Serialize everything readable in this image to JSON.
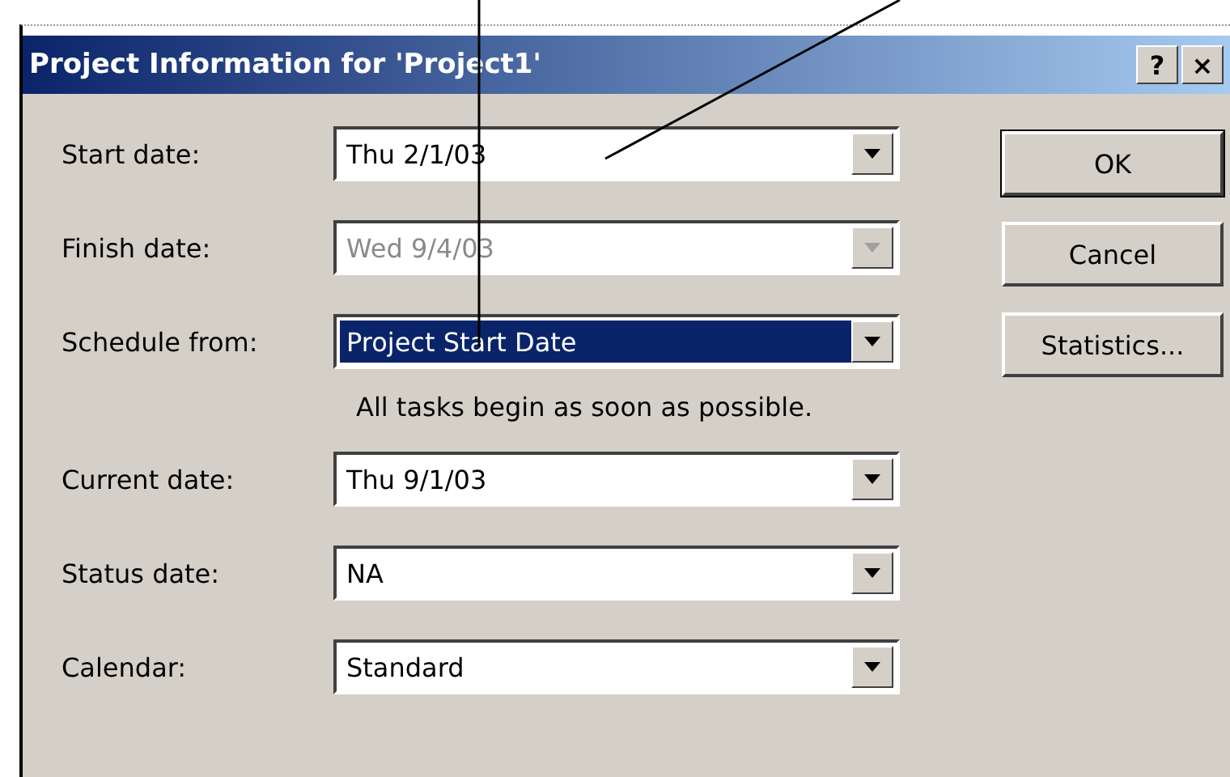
{
  "window": {
    "title": "Project Information for 'Project1'",
    "help_button": "?",
    "close_button": "×"
  },
  "fields": [
    {
      "label": "Start date:",
      "value": "Thu 2/1/03",
      "disabled": false,
      "selected": false
    },
    {
      "label": "Finish date:",
      "value": "Wed 9/4/03",
      "disabled": true,
      "selected": false
    },
    {
      "label": "Schedule from:",
      "value": "Project Start Date",
      "disabled": false,
      "selected": true
    },
    {
      "kind": "note",
      "text": "All tasks begin as soon as possible."
    },
    {
      "label": "Current date:",
      "value": "Thu 9/1/03",
      "disabled": false,
      "selected": false
    },
    {
      "label": "Status date:",
      "value": "NA",
      "disabled": false,
      "selected": false
    },
    {
      "label": "Calendar:",
      "value": "Standard",
      "disabled": false,
      "selected": false
    }
  ],
  "buttons": [
    "OK",
    "Cancel",
    "Statistics..."
  ]
}
